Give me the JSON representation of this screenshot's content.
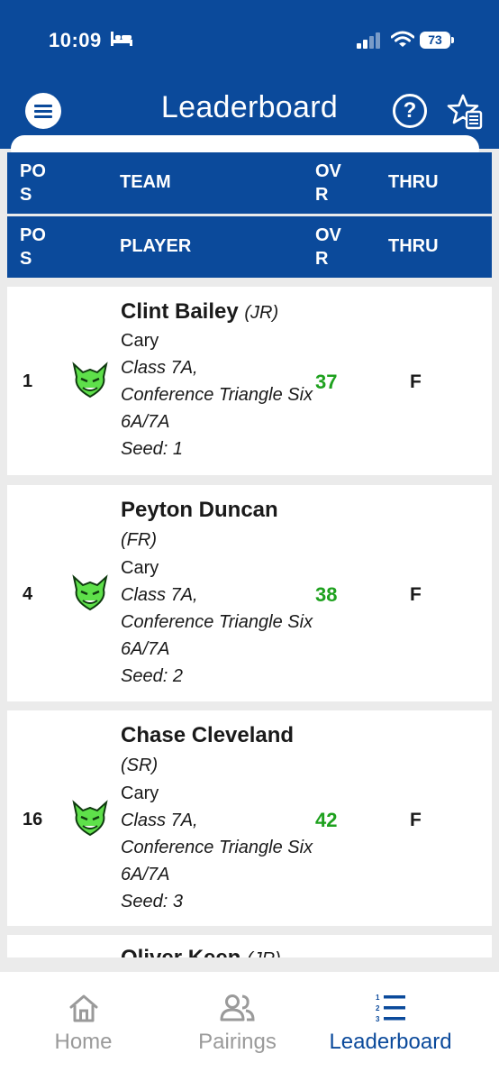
{
  "status_bar": {
    "time": "10:09",
    "battery": "73"
  },
  "header": {
    "title": "Leaderboard"
  },
  "team_header": {
    "pos": "POS",
    "name": "TEAM",
    "ovr": "OVR",
    "thru": "THRU"
  },
  "player_header": {
    "pos": "POS",
    "name": "PLAYER",
    "ovr": "OVR",
    "thru": "THRU"
  },
  "players": [
    {
      "pos": "1",
      "name": "Clint Bailey",
      "year": "(JR)",
      "school": "Cary",
      "classification": "Class 7A,",
      "conference": "Conference Triangle Six 6A/7A",
      "seed": "Seed: 1",
      "ovr": "37",
      "thru": "F"
    },
    {
      "pos": "4",
      "name": "Peyton Duncan",
      "year": "(FR)",
      "school": "Cary",
      "classification": "Class 7A,",
      "conference": "Conference Triangle Six 6A/7A",
      "seed": "Seed: 2",
      "ovr": "38",
      "thru": "F"
    },
    {
      "pos": "16",
      "name": "Chase Cleveland",
      "year": "(SR)",
      "school": "Cary",
      "classification": "Class 7A,",
      "conference": "Conference Triangle Six 6A/7A",
      "seed": "Seed: 3",
      "ovr": "42",
      "thru": "F"
    },
    {
      "name": "Oliver Keen",
      "year": "(JR)"
    }
  ],
  "tabs": [
    {
      "label": "Home",
      "icon": "home-icon",
      "active": false
    },
    {
      "label": "Pairings",
      "icon": "people-icon",
      "active": false
    },
    {
      "label": "Leaderboard",
      "icon": "leaderboard-icon",
      "active": true
    }
  ],
  "colors": {
    "primary": "#0b4a9b",
    "score_green": "#1ea11e",
    "inactive_tab": "#9a9a9a"
  }
}
